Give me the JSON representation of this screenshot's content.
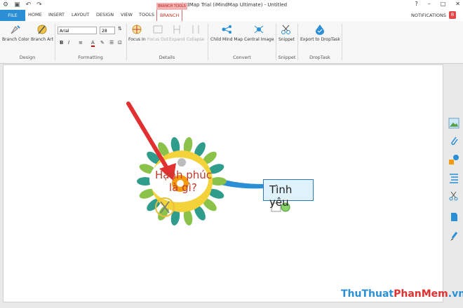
{
  "titlebar": {
    "title": "iMindMap Trial (iMindMap Ultimate) - Untitled"
  },
  "window_controls": {
    "help": "?",
    "minimize": "–",
    "maximize": "□",
    "close": "✕"
  },
  "tabs": {
    "file": "FILE",
    "home": "HOME",
    "insert": "INSERT",
    "layout": "LAYOUT",
    "design": "DESIGN",
    "view": "VIEW",
    "tools": "TOOLS",
    "branch": "BRANCH"
  },
  "context_tab_label": "BRANCH TOOLS",
  "notifications": {
    "label": "NOTIFICATIONS",
    "count": "8"
  },
  "ribbon": {
    "branch_color": "Branch Color",
    "branch_art": "Branch Art",
    "font_name": "Arial",
    "font_size": "28",
    "bold": "B",
    "italic": "I",
    "focus_in": "Focus In",
    "focus_out": "Focus Out",
    "expand": "Expand",
    "collapse": "Collapse",
    "child_mind_map": "Child Mind Map",
    "central_image": "Central Image",
    "snippet": "Snippet",
    "export_droptask": "Export to DropTask"
  },
  "groups": {
    "design": "Design",
    "formatting": "Formatting",
    "details": "Details",
    "convert": "Convert",
    "snippet": "Snippet",
    "droptask": "DropTask"
  },
  "mindmap": {
    "central_line1": "Hạnh phúc",
    "central_line2": "là gì?",
    "branch_node": "Tình yêu",
    "accent": "#2b8fd6",
    "central_text_color": "#c0392b"
  },
  "watermark": {
    "part1": "ThuThuat",
    "part2": "PhanMem",
    "part3": ".vn"
  }
}
